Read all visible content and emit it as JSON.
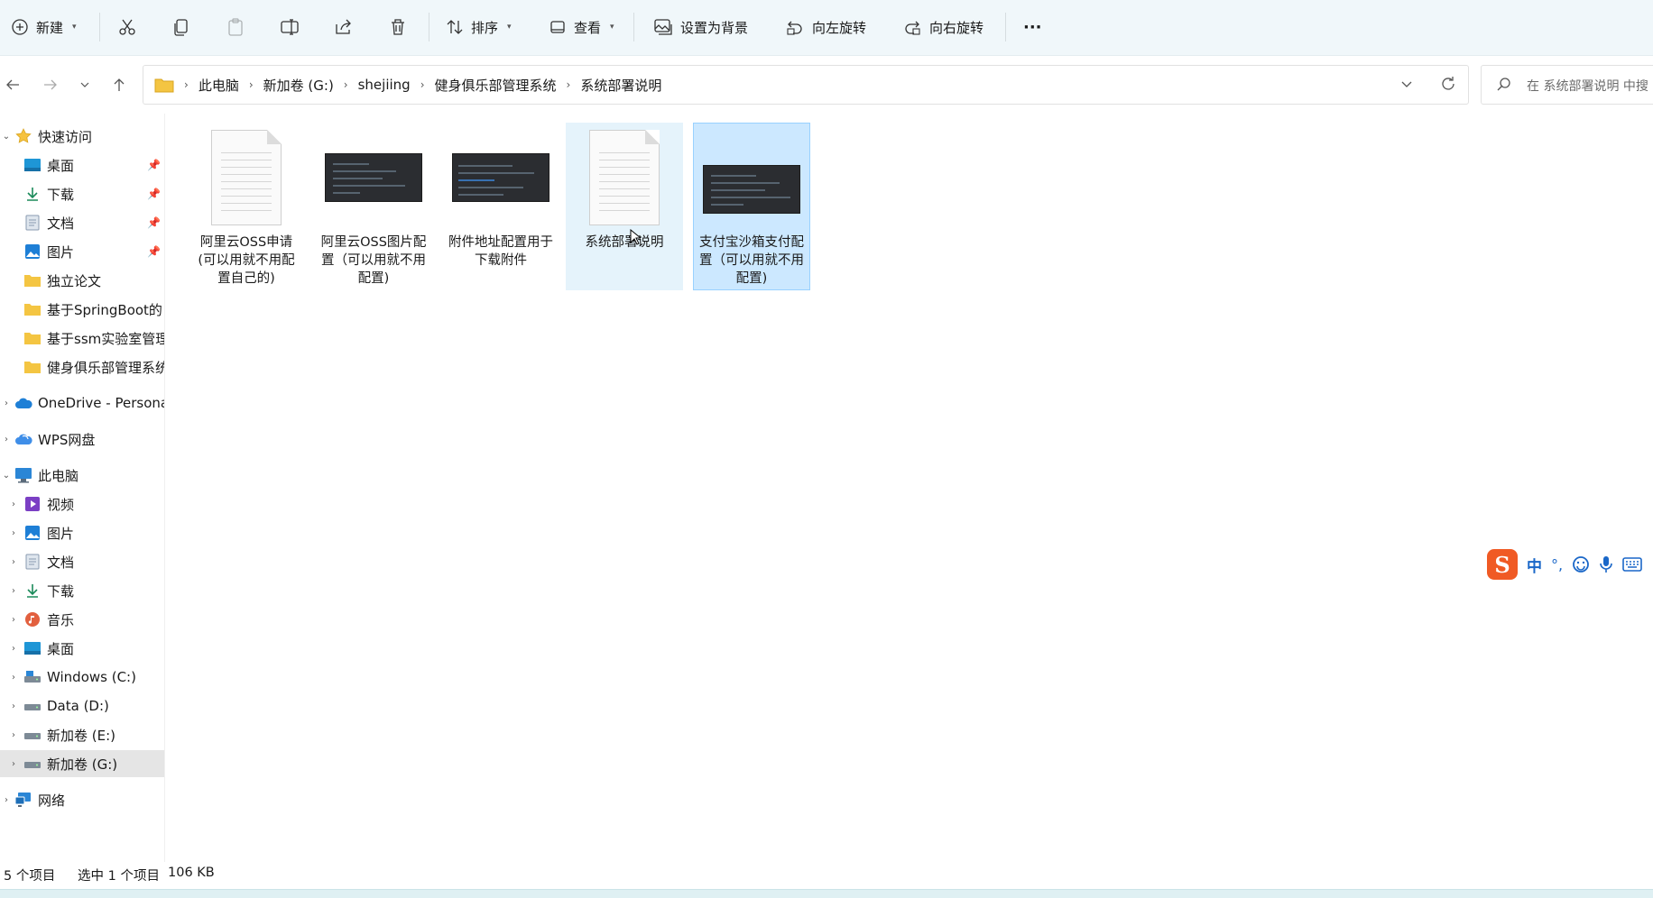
{
  "toolbar": {
    "new_label": "新建",
    "sort_label": "排序",
    "view_label": "查看",
    "set_background_label": "设置为背景",
    "rotate_left_label": "向左旋转",
    "rotate_right_label": "向右旋转",
    "more_label": "···"
  },
  "address": {
    "crumbs": [
      "此电脑",
      "新加卷 (G:)",
      "shejiing",
      "健身俱乐部管理系统",
      "系统部署说明"
    ]
  },
  "search": {
    "placeholder": "在 系统部署说明 中搜"
  },
  "nav": {
    "quick_access": "快速访问",
    "qa_items": [
      {
        "label": "桌面",
        "icon": "desktop-icon",
        "pinned": true
      },
      {
        "label": "下载",
        "icon": "download-icon",
        "pinned": true
      },
      {
        "label": "文档",
        "icon": "document-icon",
        "pinned": true
      },
      {
        "label": "图片",
        "icon": "picture-icon",
        "pinned": true
      },
      {
        "label": "独立论文",
        "icon": "folder-icon",
        "pinned": false
      },
      {
        "label": "基于SpringBoot的",
        "icon": "folder-icon",
        "pinned": false
      },
      {
        "label": "基于ssm实验室管理",
        "icon": "folder-icon",
        "pinned": false
      },
      {
        "label": "健身俱乐部管理系统",
        "icon": "folder-icon",
        "pinned": false
      }
    ],
    "onedrive": "OneDrive - Persona",
    "wps": "WPS网盘",
    "this_pc": "此电脑",
    "pc_items": [
      {
        "label": "视频",
        "icon": "video-icon"
      },
      {
        "label": "图片",
        "icon": "picture-icon"
      },
      {
        "label": "文档",
        "icon": "document-icon"
      },
      {
        "label": "下载",
        "icon": "download-icon"
      },
      {
        "label": "音乐",
        "icon": "music-icon"
      },
      {
        "label": "桌面",
        "icon": "desktop-icon"
      },
      {
        "label": "Windows (C:)",
        "icon": "drive-icon"
      },
      {
        "label": "Data (D:)",
        "icon": "drive-icon"
      },
      {
        "label": "新加卷 (E:)",
        "icon": "drive-icon"
      },
      {
        "label": "新加卷 (G:)",
        "icon": "drive-icon",
        "selected": true
      }
    ],
    "network": "网络"
  },
  "files": [
    {
      "name": "阿里云OSS申请(可以用就不用配置自己的)",
      "type": "document",
      "state": "normal"
    },
    {
      "name": "阿里云OSS图片配置（可以用就不用配置)",
      "type": "screenshot",
      "state": "normal"
    },
    {
      "name": "附件地址配置用于下载附件",
      "type": "screenshot",
      "state": "normal"
    },
    {
      "name": "系统部署说明",
      "type": "document",
      "state": "hover"
    },
    {
      "name": "支付宝沙箱支付配置（可以用就不用配置)",
      "type": "screenshot",
      "state": "selected"
    }
  ],
  "ime": {
    "logo": "S",
    "mode": "中",
    "punct": "°,"
  },
  "status": {
    "count": "5 个项目",
    "selection": "选中 1 个项目",
    "size": "106 KB"
  },
  "colors": {
    "toolbar_bg": "#f0f7fa",
    "selection_bg": "#cce8ff",
    "selection_border": "#99d1ff",
    "hover_bg": "#e5f3fb",
    "folder": "#f4c542",
    "ime_orange": "#f05a24",
    "ime_blue": "#1a67c8"
  }
}
